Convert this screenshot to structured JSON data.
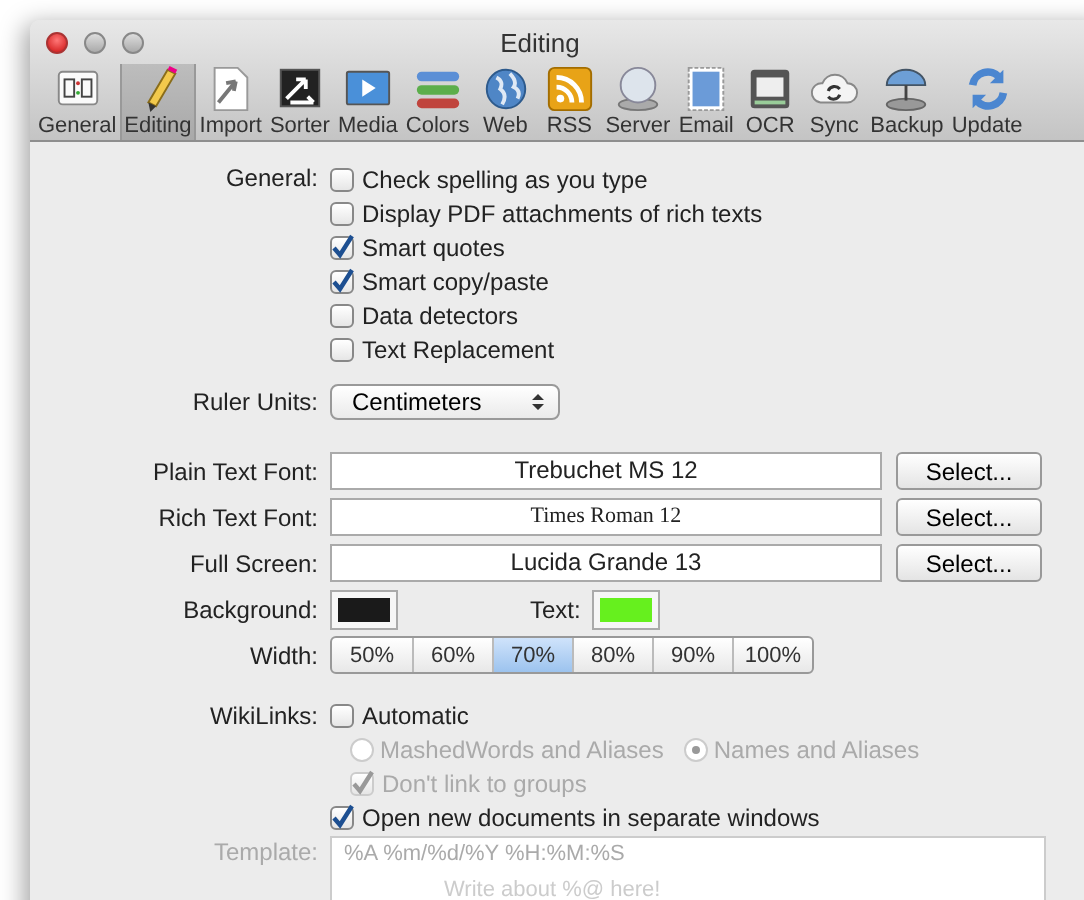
{
  "window": {
    "title": "Editing"
  },
  "toolbar": [
    {
      "label": "General",
      "selected": false
    },
    {
      "label": "Editing",
      "selected": true
    },
    {
      "label": "Import",
      "selected": false
    },
    {
      "label": "Sorter",
      "selected": false
    },
    {
      "label": "Media",
      "selected": false
    },
    {
      "label": "Colors",
      "selected": false
    },
    {
      "label": "Web",
      "selected": false
    },
    {
      "label": "RSS",
      "selected": false
    },
    {
      "label": "Server",
      "selected": false
    },
    {
      "label": "Email",
      "selected": false
    },
    {
      "label": "OCR",
      "selected": false
    },
    {
      "label": "Sync",
      "selected": false
    },
    {
      "label": "Backup",
      "selected": false
    },
    {
      "label": "Update",
      "selected": false
    }
  ],
  "general": {
    "label": "General:",
    "options": [
      {
        "label": "Check spelling as you type",
        "checked": false
      },
      {
        "label": "Display PDF attachments of rich texts",
        "checked": false
      },
      {
        "label": "Smart quotes",
        "checked": true
      },
      {
        "label": "Smart copy/paste",
        "checked": true
      },
      {
        "label": "Data detectors",
        "checked": false
      },
      {
        "label": "Text Replacement",
        "checked": false
      }
    ]
  },
  "ruler_units": {
    "label": "Ruler Units:",
    "value": "Centimeters"
  },
  "fonts": [
    {
      "label": "Plain Text Font:",
      "value": "Trebuchet MS 12",
      "button": "Select..."
    },
    {
      "label": "Rich Text Font:",
      "value": "Times Roman 12",
      "button": "Select..."
    },
    {
      "label": "Full Screen:",
      "value": "Lucida Grande 13",
      "button": "Select..."
    }
  ],
  "colors": [
    {
      "label": "Background:",
      "color": "#1a1a1a"
    },
    {
      "label": "Text:",
      "color": "#66f01e"
    }
  ],
  "width": {
    "label": "Width:",
    "options": [
      {
        "label": "50%",
        "selected": false
      },
      {
        "label": "60%",
        "selected": false
      },
      {
        "label": "70%",
        "selected": true
      },
      {
        "label": "80%",
        "selected": false
      },
      {
        "label": "90%",
        "selected": false
      },
      {
        "label": "100%",
        "selected": false
      }
    ]
  },
  "wikilinks": {
    "label": "WikiLinks:",
    "automatic": {
      "label": "Automatic",
      "checked": false,
      "disabled": false
    },
    "modes": [
      {
        "label": "MashedWords and Aliases",
        "selected": false,
        "disabled": true
      },
      {
        "label": "Names and Aliases",
        "selected": true,
        "disabled": true
      }
    ],
    "dont_link": {
      "label": "Don't link to groups",
      "checked": true,
      "disabled": true
    }
  },
  "open_separate": {
    "label": "Open new documents in separate windows",
    "checked": true,
    "disabled": false
  },
  "template": {
    "label": "Template:",
    "disabled": true,
    "lines": [
      "%A %m/%d/%Y %H:%M:%S",
      "Write about %@ here!"
    ]
  }
}
